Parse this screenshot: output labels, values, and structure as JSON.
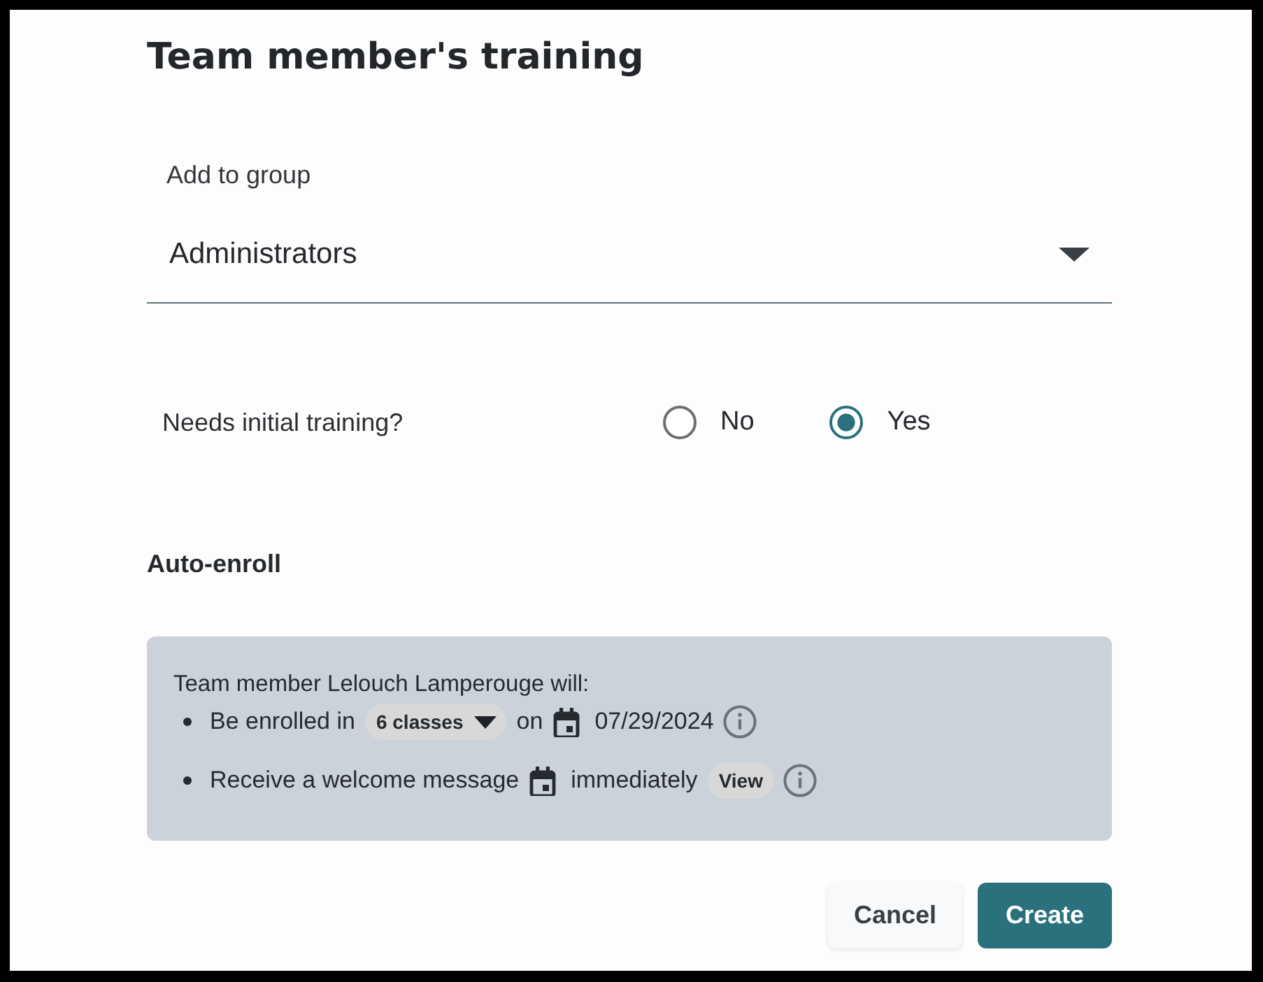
{
  "title": "Team member's training",
  "group": {
    "label": "Add to group",
    "value": "Administrators"
  },
  "initial_training": {
    "question": "Needs initial training?",
    "options": [
      {
        "label": "No",
        "selected": false
      },
      {
        "label": "Yes",
        "selected": true
      }
    ]
  },
  "auto_enroll": {
    "heading": "Auto-enroll",
    "intro": "Team member Lelouch Lamperouge will:",
    "items": [
      {
        "parts": [
          {
            "kind": "text",
            "text": "Be enrolled in"
          },
          {
            "kind": "dropdown",
            "text": "6 classes"
          },
          {
            "kind": "text",
            "text": "on"
          },
          {
            "kind": "date",
            "text": "07/29/2024"
          }
        ],
        "info": true
      },
      {
        "parts": [
          {
            "kind": "text",
            "text": "Receive a welcome message"
          },
          {
            "kind": "date",
            "text": "immediately"
          },
          {
            "kind": "button",
            "text": "View"
          }
        ],
        "info": true
      }
    ]
  },
  "buttons": [
    {
      "label": "Cancel",
      "kind": "secondary"
    },
    {
      "label": "Create",
      "kind": "primary"
    }
  ]
}
